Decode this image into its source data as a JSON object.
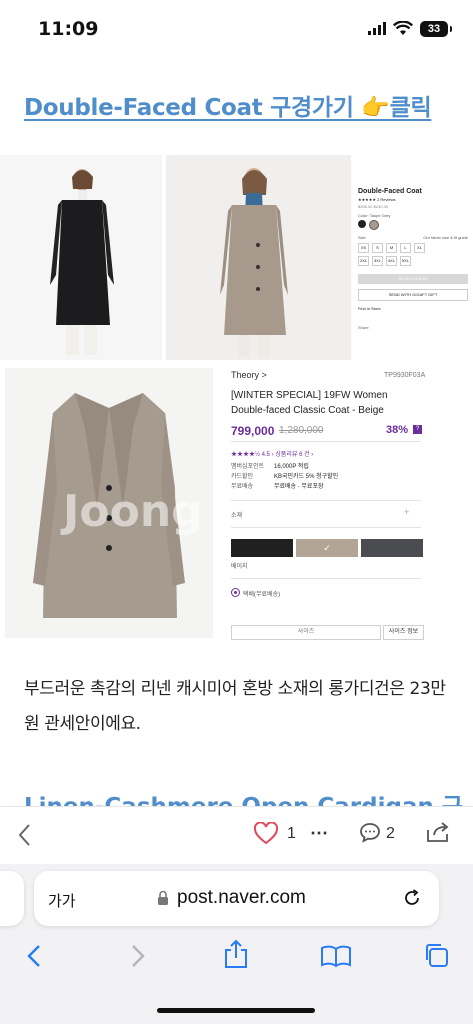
{
  "status_bar": {
    "time": "11:09",
    "battery": "33"
  },
  "article": {
    "link_title": "Double-Faced Coat 구경가기 👉클릭",
    "paragraph": "부드러운 촉감의 리넨 캐시미어 혼방 소재의 롱가디건은 23만원 관세안이에요.",
    "next_title": "Linen-Cashmere Open Cardigan 구"
  },
  "shop_side": {
    "title": "Double-Faced Coat",
    "reviews": "★★★★★ 2 Reviews",
    "price": "$395.00 $240.00",
    "color_label": "Color: Taupe Grey",
    "size_label": "Size",
    "size_guide": "Our fabric size & fit guide",
    "sizes": [
      "XS",
      "S",
      "M",
      "L",
      "XL",
      "2XL",
      "3XL",
      "4XL",
      "5XL"
    ],
    "select_btn": "SELECT A SIZE",
    "wishlist_btn": "SEND WITH GIGAFT GIFT",
    "pickup": "Find in Store",
    "share": "Share"
  },
  "product": {
    "brand": "Theory >",
    "code": "TP9930F03A",
    "name_line1": "[WINTER SPECIAL] 19FW Women",
    "name_line2": "Double-faced Classic Coat - Beige",
    "price": "799,000",
    "price_old": "1,280,000",
    "discount": "38%",
    "rating": "★★★★½  4.5  › 상품리뷰 6 건 ›",
    "point_label": "멤버십포인트",
    "point_value": "16,000P 적립",
    "card_label": "카드할인",
    "card_value": "KB국민카드 5% 청구할인",
    "ship_label": "무료배송",
    "ship_value": "무료배송 · 무료포장",
    "material_label": "소재",
    "color_name": "베이지",
    "delivery": "택배(무료배송)",
    "size_select": "사이즈",
    "size_info": "사이즈 정보",
    "watermark": "Joong"
  },
  "blog_bar": {
    "likes": "1",
    "comments": "2"
  },
  "browser": {
    "text_size": "가가",
    "url": "post.naver.com"
  },
  "colors": {
    "link": "#4f8ecb",
    "price": "#6a2d9a"
  }
}
